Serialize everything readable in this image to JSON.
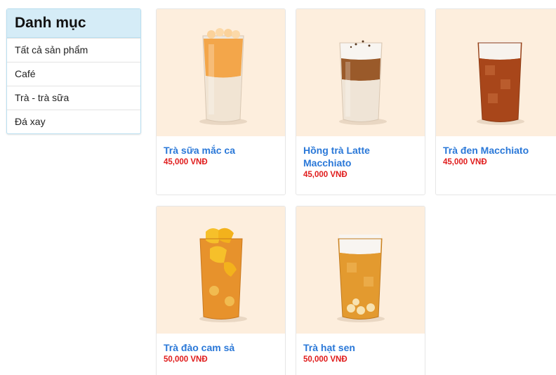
{
  "sidebar": {
    "title": "Danh mục",
    "items": [
      {
        "label": "Tất cả sản phẩm"
      },
      {
        "label": "Café"
      },
      {
        "label": "Trà - trà sữa"
      },
      {
        "label": "Đá xay"
      }
    ]
  },
  "products": [
    {
      "name": "Trà sữa mắc ca",
      "price": "45,000 VNĐ",
      "image": "milk-tea-macadamia-icon"
    },
    {
      "name": "Hồng trà Latte Macchiato",
      "price": "45,000 VNĐ",
      "image": "latte-macchiato-icon"
    },
    {
      "name": "Trà đen Macchiato",
      "price": "45,000 VNĐ",
      "image": "black-tea-macchiato-icon"
    },
    {
      "name": "Trà đào cam sả",
      "price": "50,000 VNĐ",
      "image": "peach-tea-icon"
    },
    {
      "name": "Trà hạt sen",
      "price": "50,000 VNĐ",
      "image": "lotus-seed-tea-icon"
    }
  ],
  "colors": {
    "accent": "#2a78d8",
    "price": "#e01b1b",
    "sidebar_header": "#d5ecf7",
    "image_bg": "#fdeedd"
  }
}
